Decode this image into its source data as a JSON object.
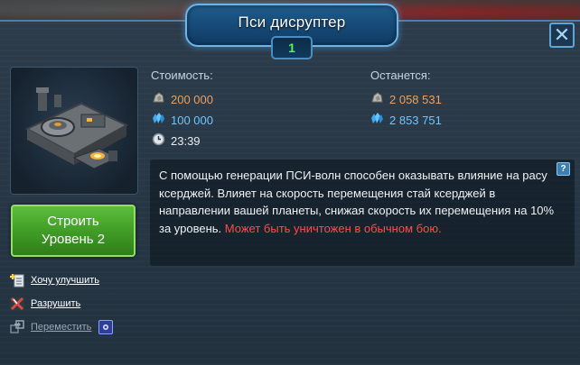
{
  "dialog": {
    "title": "Пси дисруптер",
    "level": "1",
    "close_icon": "close-icon"
  },
  "cost": {
    "header": "Стоимость:",
    "ore": "200 000",
    "crystal": "100 000",
    "time": "23:39"
  },
  "remaining": {
    "header": "Останется:",
    "ore": "2 058 531",
    "crystal": "2 853 751"
  },
  "build_button": {
    "line1": "Строить",
    "line2": "Уровень 2"
  },
  "actions": [
    {
      "label": "Хочу улучшить",
      "icon": "wishlist-add-icon",
      "enabled": true
    },
    {
      "label": "Разрушить",
      "icon": "destroy-icon",
      "enabled": true
    },
    {
      "label": "Переместить",
      "icon": "move-icon",
      "enabled": false
    }
  ],
  "description": {
    "main": "С помощью генерации ПСИ-волн способен оказывать влияние на расу ксерджей. Влияет на скорость перемещения стай ксерджей в направлении вашей планеты, снижая скорость их перемещения на 10% за уровень.",
    "warning": "Может быть уничтожен в обычном бою.",
    "help_label": "?"
  },
  "colors": {
    "ore": "#f0a060",
    "crystal": "#6fc6ff",
    "warning": "#ff4b4b",
    "level": "#5df255",
    "build_button": "#4aa82c"
  }
}
